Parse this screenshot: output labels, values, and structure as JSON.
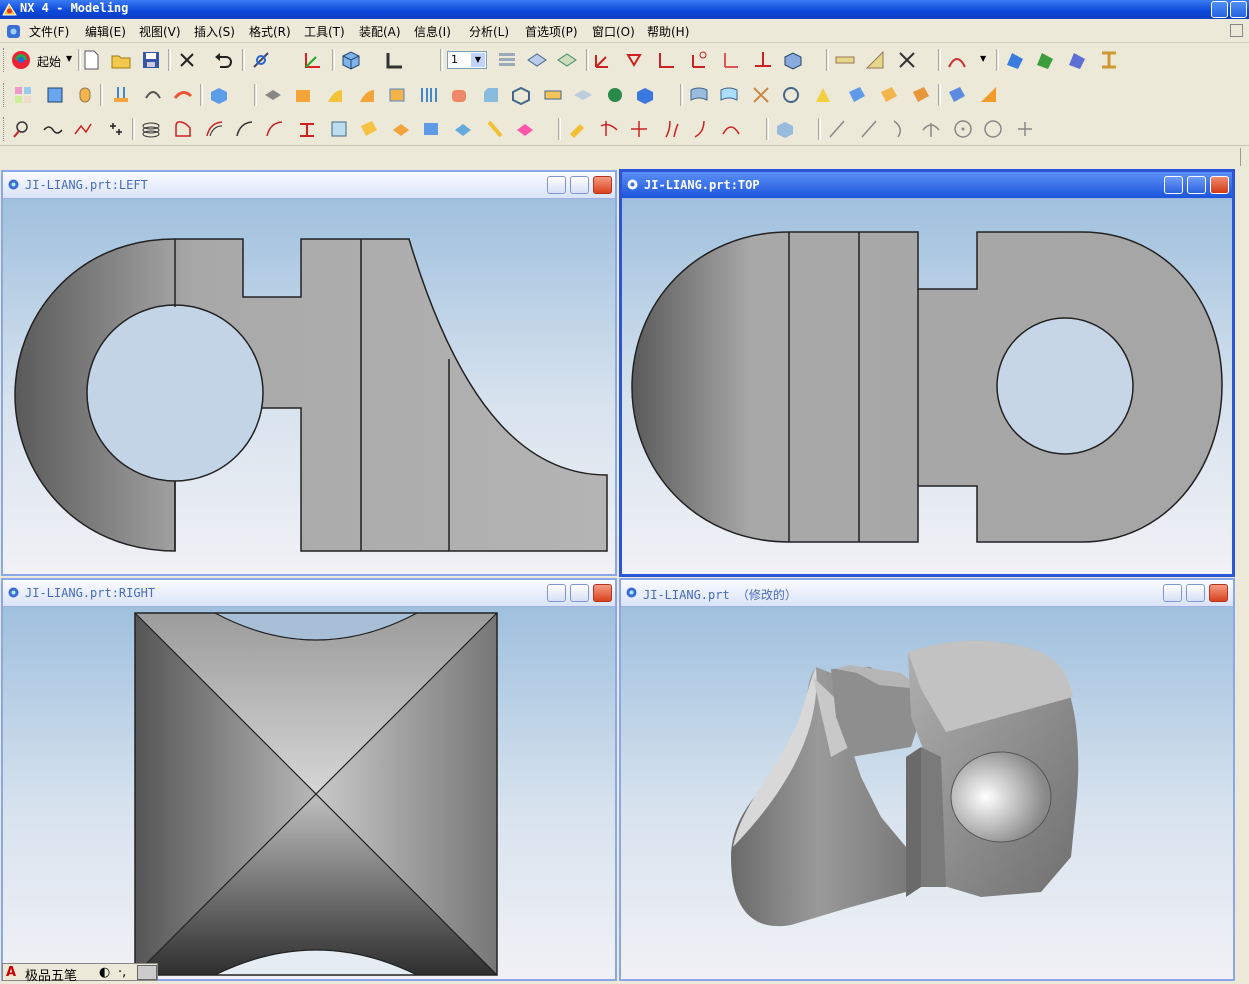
{
  "window": {
    "title": "NX 4 - Modeling"
  },
  "menu": [
    {
      "label": "文件(F)"
    },
    {
      "label": "编辑(E)"
    },
    {
      "label": "视图(V)"
    },
    {
      "label": "插入(S)"
    },
    {
      "label": "格式(R)"
    },
    {
      "label": "工具(T)"
    },
    {
      "label": "装配(A)"
    },
    {
      "label": "信息(I)"
    },
    {
      "label": "分析(L)"
    },
    {
      "label": "首选项(P)"
    },
    {
      "label": "窗口(O)"
    },
    {
      "label": "帮助(H)"
    }
  ],
  "toolbar": {
    "start_label": "起始",
    "layer_select_value": "1"
  },
  "viewports": {
    "left": {
      "title": "JI-LIANG.prt:LEFT"
    },
    "top": {
      "title": "JI-LIANG.prt:TOP"
    },
    "right": {
      "title": "JI-LIANG.prt:RIGHT"
    },
    "iso": {
      "title": "JI-LIANG.prt （修改的）"
    }
  },
  "ime": {
    "mode_label": "A",
    "name": "极品五笔",
    "moon": "◐",
    "punct": "·,"
  },
  "colors": {
    "titlebar": "#0a47d8",
    "active_viewport_border": "#2a55d8",
    "part_dark": "#5a5a5a",
    "part_light": "#bdbdbd"
  }
}
